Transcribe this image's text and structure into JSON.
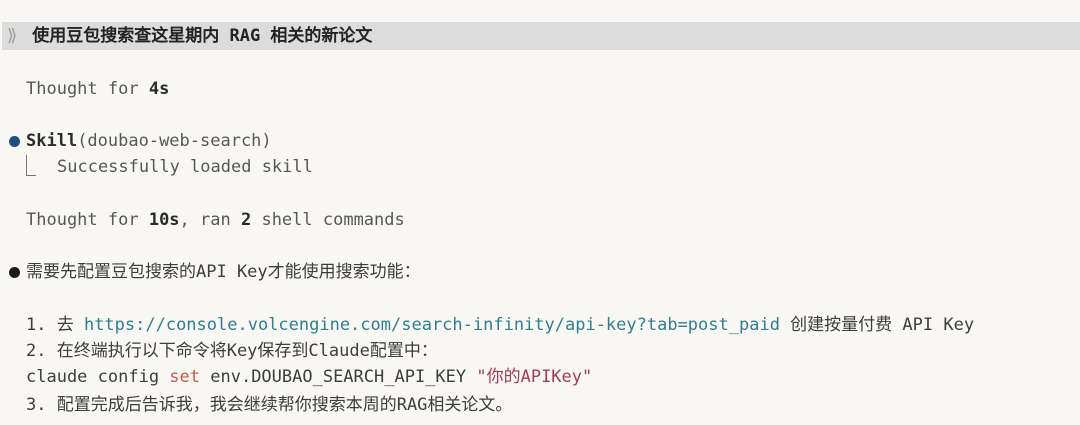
{
  "prompt": {
    "chevron": "⟫",
    "text": "使用豆包搜索查这星期内 RAG 相关的新论文"
  },
  "thought1": {
    "prefix": "Thought for ",
    "duration": "4s"
  },
  "skill": {
    "name": "Skill",
    "args": "(doubao-web-search)",
    "result": "Successfully loaded skill"
  },
  "thought2": {
    "prefix": "Thought for ",
    "duration": "10s",
    "mid": ", ran ",
    "count": "2",
    "suffix": " shell commands"
  },
  "message": {
    "intro": "需要先配置豆包搜索的API Key才能使用搜索功能：",
    "step1_prefix": "1. 去 ",
    "step1_link": "https://console.volcengine.com/search-infinity/api-key?tab=post_paid",
    "step1_suffix": " 创建按量付费 API Key",
    "step2": "2. 在终端执行以下命令将Key保存到Claude配置中：",
    "cmd_start": "claude config ",
    "cmd_kw": "set",
    "cmd_mid": " env.DOUBAO_SEARCH_API_KEY ",
    "cmd_str": "\"你的APIKey\"",
    "step3": "3. 配置完成后告诉我，我会继续帮你搜索本周的RAG相关论文。"
  },
  "colors": {
    "background": "#f8f7f4",
    "prompt_bar": "#dcdcdc",
    "skill_dot": "#1f4e87",
    "message_dot": "#1a1a1a",
    "link": "#2f7f8f",
    "keyword": "#c9584a",
    "string": "#a33a5b"
  }
}
